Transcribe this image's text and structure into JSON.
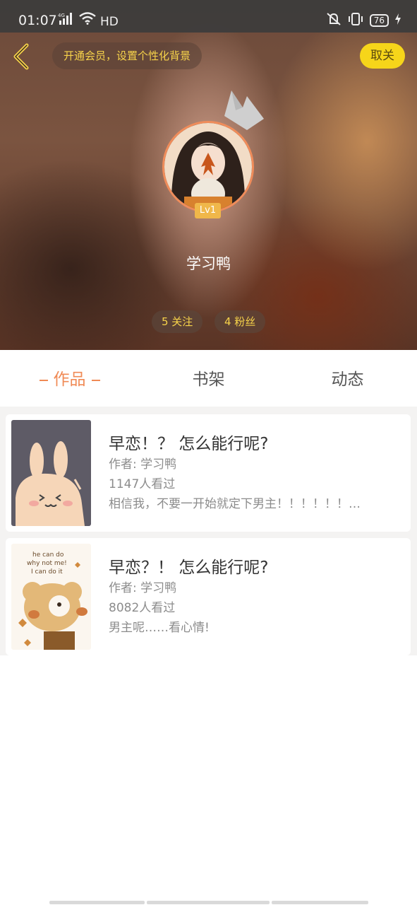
{
  "status_bar": {
    "time": "01:07",
    "network": "4G",
    "hd": "HD",
    "battery": "76"
  },
  "header": {
    "vip_promo": "开通会员，设置个性化背景",
    "follow_button": "取关",
    "level": "Lv1",
    "username": "学习鸭",
    "following": "5 关注",
    "followers": "4 粉丝"
  },
  "tabs": [
    {
      "label": "作品",
      "active": true
    },
    {
      "label": "书架",
      "active": false
    },
    {
      "label": "动态",
      "active": false
    }
  ],
  "works": [
    {
      "title": "早恋！？ 怎么能行呢?",
      "author": "作者: 学习鸭",
      "views": "1147人看过",
      "summary": "相信我，不要一开始就定下男主！！！！！！…"
    },
    {
      "title": "早恋？！ 怎么能行呢?",
      "author": "作者: 学习鸭",
      "views": "8082人看过",
      "summary": "男主呢……看心情!",
      "cover_text": [
        "he can do",
        "why not me!",
        "I can do it"
      ]
    }
  ],
  "colors": {
    "accent_orange": "#f08a55",
    "accent_yellow": "#f6d51a",
    "pill_text": "#f7d34a"
  },
  "icons": [
    "back-arrow-icon",
    "crown-icon",
    "wifi-icon",
    "signal-icon",
    "mute-icon",
    "vibrate-icon",
    "battery-icon",
    "charging-icon"
  ]
}
